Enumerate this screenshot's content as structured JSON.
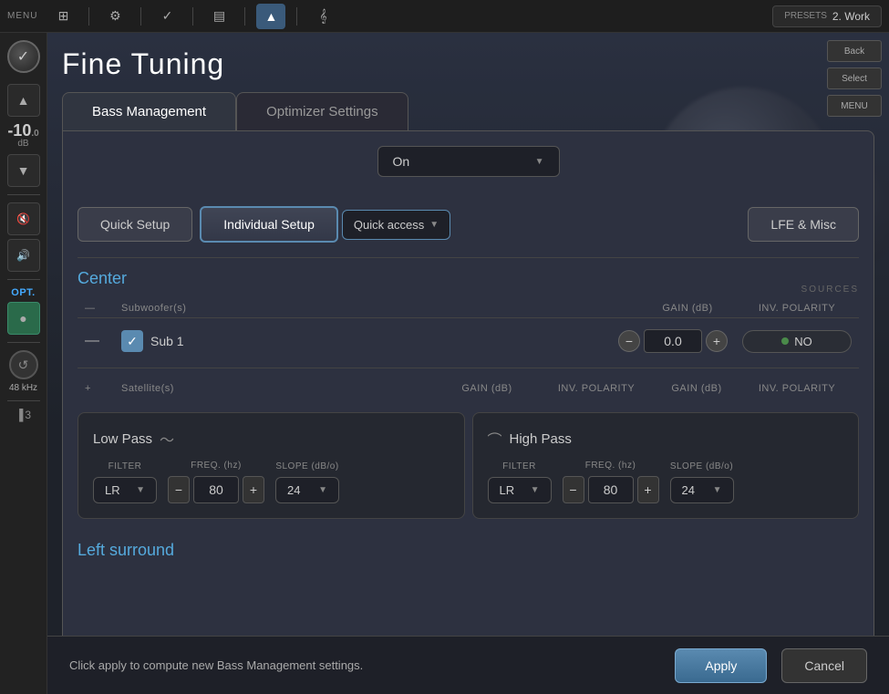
{
  "topbar": {
    "menu_label": "MENU",
    "presets_label": "PRESETS",
    "preset_value": "2. Work"
  },
  "sidebar": {
    "volume_value": "-10",
    "volume_decimal": ".0",
    "volume_unit": "dB",
    "freq_label": "48 kHz",
    "opt_label": "OPT."
  },
  "page": {
    "title": "Fine Tuning",
    "sources_label": "SOURCES"
  },
  "right_panel": {
    "back_label": "Back",
    "select_label": "Select",
    "menu_label": "MENU"
  },
  "tabs": [
    {
      "label": "Bass Management",
      "active": true
    },
    {
      "label": "Optimizer Settings",
      "active": false
    }
  ],
  "on_dropdown": {
    "value": "On",
    "placeholder": "On"
  },
  "setup_buttons": {
    "quick_setup": "Quick Setup",
    "individual_setup": "Individual Setup",
    "quick_access": "Quick access",
    "lfe_misc": "LFE & Misc"
  },
  "center_section": {
    "title": "Center",
    "subwoofer_label": "Subwoofer(s)",
    "gain_db_label": "GAIN (dB)",
    "inv_polarity_label": "INV. POLARITY",
    "satellite_label": "Satellite(s)",
    "gain_db_label2": "GAIN (dB)",
    "inv_polarity_label2": "INV. POLARITY",
    "gain_db_label3": "GAIN (dB)",
    "inv_polarity_label3": "INV. POLARITY",
    "sub1_name": "Sub 1",
    "sub1_gain": "0.0",
    "sub1_polarity": "NO"
  },
  "low_pass": {
    "title": "Low Pass",
    "filter_label": "FILTER",
    "freq_label": "FREQ. (hz)",
    "slope_label": "SLOPE (dB/o)",
    "filter_value": "LR",
    "freq_value": "80",
    "slope_value": "24"
  },
  "high_pass": {
    "title": "High Pass",
    "filter_label": "FILTER",
    "freq_label": "FREQ. (hz)",
    "slope_label": "SLOPE (dB/o)",
    "filter_value": "LR",
    "freq_value": "80",
    "slope_value": "24"
  },
  "left_surround": {
    "title": "Left surround"
  },
  "bottom_bar": {
    "message": "Click apply to compute new Bass Management settings.",
    "apply_label": "Apply",
    "cancel_label": "Cancel"
  }
}
